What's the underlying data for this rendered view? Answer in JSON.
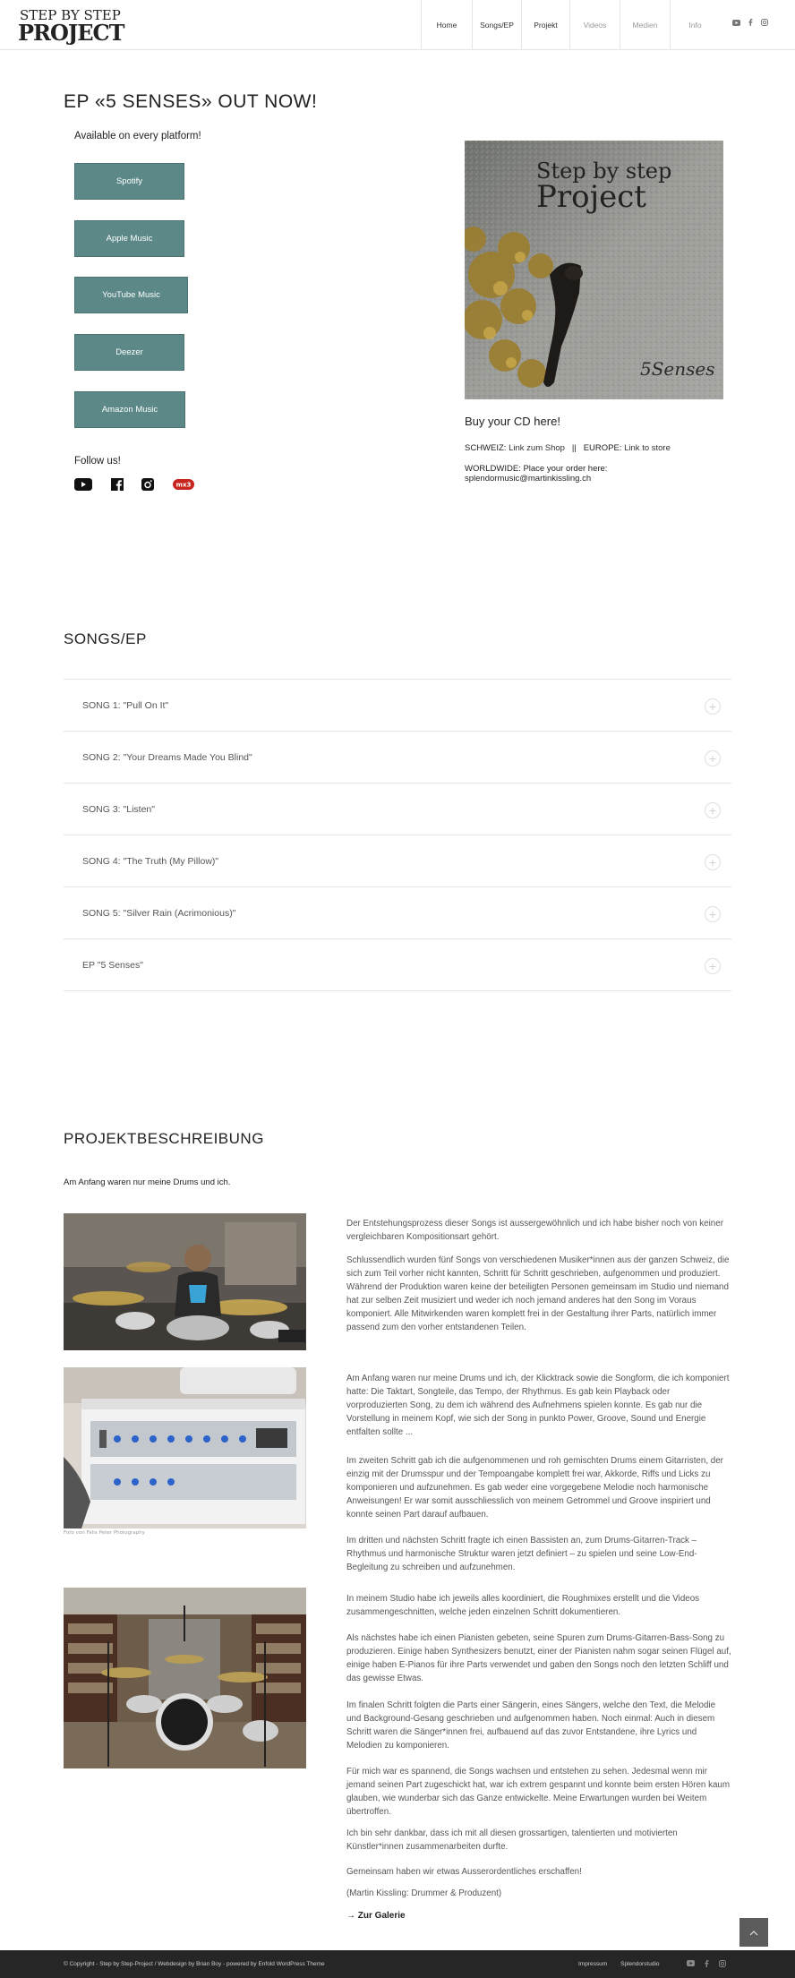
{
  "header": {
    "logo_line1": "STEP BY STEP",
    "logo_line2": "PROJECT",
    "nav": [
      "Home",
      "Songs/EP",
      "Projekt",
      "Videos",
      "Medien",
      "Info"
    ],
    "social": [
      "youtube-icon",
      "facebook-icon",
      "instagram-icon"
    ]
  },
  "ep": {
    "title": "EP «5 SENSES» OUT NOW!",
    "available": "Available on every platform!",
    "buttons": [
      "Spotify",
      "Apple Music",
      "YouTube Music",
      "Deezer",
      "Amazon Music"
    ],
    "follow": "Follow us!",
    "follow_icons": [
      "youtube-icon",
      "facebook-icon",
      "instagram-icon",
      "mx3-icon"
    ],
    "cover_title_1": "Step by step",
    "cover_title_2": "Project",
    "cover_subtitle": "5Senses",
    "buy_title": "Buy your CD here!",
    "schweiz_label": "SCHWEIZ:",
    "schweiz_link": "Link zum Shop",
    "separator": "||",
    "europe_label": "EUROPE:",
    "europe_link": "Link to store",
    "worldwide_label": "WORLDWIDE: Place your order here:",
    "worldwide_email": "splendormusic@martinkissling.ch"
  },
  "songs": {
    "title": "SONGS/EP",
    "items": [
      "SONG 1: \"Pull On It\"",
      "SONG 2: \"Your Dreams Made You Blind\"",
      "SONG 3: \"Listen\"",
      "SONG 4: \"The Truth (My Pillow)\"",
      "SONG 5: \"Silver Rain (Acrimonious)\"",
      "EP \"5 Senses\""
    ]
  },
  "projekt": {
    "title": "PROJEKTBESCHREIBUNG",
    "intro": "Am Anfang waren nur meine Drums und ich.",
    "caption": "Foto von Felix Peter Photography",
    "paragraphs": [
      "Der Entstehungsprozess dieser Songs ist aussergewöhnlich und ich habe bisher noch von keiner vergleichbaren Kompositionsart gehört.",
      "Schlussendlich wurden fünf Songs von verschiedenen Musiker*innen aus der ganzen Schweiz, die sich zum Teil vorher nicht kannten, Schritt für Schritt geschrieben, aufgenommen und produziert. Während der Produktion waren keine der beteiligten Personen gemeinsam im Studio und niemand hat zur selben Zeit musiziert und weder ich noch jemand anderes hat den Song im Voraus komponiert. Alle Mitwirkenden waren komplett frei in der Gestaltung ihrer Parts, natürlich immer passend zum den vorher entstandenen Teilen.",
      "Am Anfang waren nur meine Drums und ich, der Klicktrack sowie die Songform, die ich komponiert hatte: Die Taktart, Songteile, das Tempo, der Rhythmus. Es gab kein Playback oder vorproduzierten Song, zu dem ich während des Aufnehmens spielen konnte. Es gab nur die Vorstellung in meinem Kopf, wie sich der Song in punkto Power, Groove, Sound und Energie entfalten sollte ...",
      "Im zweiten Schritt gab ich die aufgenommenen und roh gemischten Drums einem Gitarristen, der einzig mit der Drumsspur und der Tempoangabe komplett frei war, Akkorde, Riffs und Licks zu komponieren und aufzunehmen. Es gab weder eine vorgegebene Melodie noch harmonische Anweisungen! Er war somit ausschliesslich von meinem Getrommel und Groove inspiriert und konnte seinen Part darauf aufbauen.",
      "Im dritten und nächsten Schritt fragte ich einen Bassisten an, zum Drums-Gitarren-Track – Rhythmus und harmonische Struktur waren jetzt definiert – zu spielen und seine Low-End-Begleitung zu schreiben und aufzunehmen.",
      "In meinem Studio habe ich jeweils alles koordiniert, die Roughmixes erstellt und die Videos zusammengeschnitten, welche jeden einzelnen Schritt dokumentieren.",
      "Als nächstes habe ich einen Pianisten gebeten, seine Spuren zum Drums-Gitarren-Bass-Song zu produzieren. Einige haben Synthesizers benutzt, einer der Pianisten nahm sogar seinen Flügel auf, einige haben E-Pianos für ihre Parts verwendet und gaben den Songs noch den letzten Schliff und das gewisse Etwas.",
      "Im finalen Schritt folgten die Parts einer Sängerin, eines Sängers, welche den Text, die Melodie und Background-Gesang geschrieben und aufgenommen haben. Noch einmal: Auch in diesem Schritt waren die Sänger*innen frei, aufbauend auf das zuvor Entstandene, ihre Lyrics und Melodien zu komponieren.",
      "Für mich war es spannend, die Songs wachsen und entstehen zu sehen. Jedesmal wenn mir jemand seinen Part zugeschickt hat, war ich extrem gespannt und konnte beim ersten Hören kaum glauben, wie wunderbar sich das Ganze entwickelte. Meine Erwartungen wurden bei Weitem übertroffen.",
      "Ich bin sehr dankbar, dass ich mit all diesen grossartigen, talentierten und motivierten Künstler*innen zusammenarbeiten durfte.",
      "Gemeinsam haben wir etwas Ausserordentliches erschaffen!",
      "(Martin Kissling: Drummer & Produzent)"
    ],
    "gallery_link": "→ Zur Galerie"
  },
  "footer": {
    "copyright": "© Copyright - Step by Step-Project / Webdesign by Brian Boy - powered by Enfold WordPress Theme",
    "links": [
      "Impressum",
      "Splendorstudio"
    ],
    "social": [
      "youtube-icon",
      "facebook-icon",
      "instagram-icon"
    ],
    "to_top": "scroll-to-top-icon"
  }
}
